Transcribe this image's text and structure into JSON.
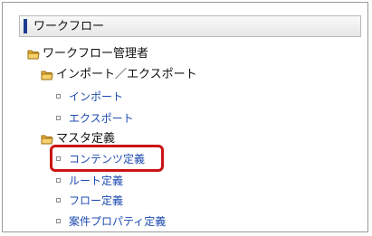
{
  "panel": {
    "title": "ワークフロー"
  },
  "tree": {
    "root": {
      "label": "ワークフロー管理者"
    },
    "import_export": {
      "label": "インポート／エクスポート",
      "children": [
        {
          "label": "インポート"
        },
        {
          "label": "エクスポート"
        }
      ]
    },
    "master": {
      "label": "マスタ定義",
      "children": [
        {
          "label": "コンテンツ定義"
        },
        {
          "label": "ルート定義"
        },
        {
          "label": "フロー定義"
        },
        {
          "label": "案件プロパティ定義"
        }
      ]
    }
  },
  "colors": {
    "accent_bar": "#1c3d8f",
    "link": "#1d4bb0",
    "highlight": "#cc1414"
  },
  "highlighted_item": "コンテンツ定義"
}
